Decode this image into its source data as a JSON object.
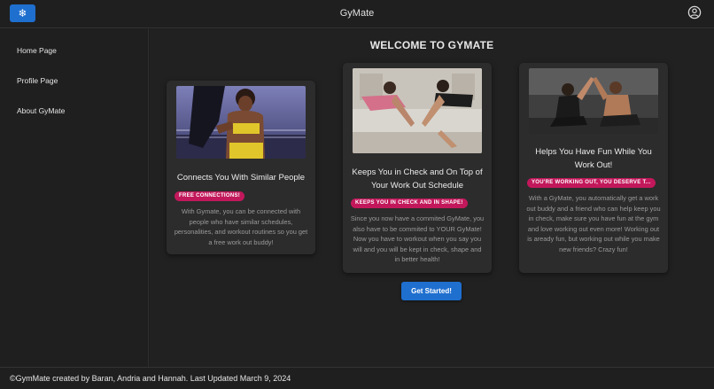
{
  "app": {
    "title": "GyMate",
    "menu_icon": "snowflake-menu-icon",
    "account_icon": "account-circle-icon"
  },
  "sidebar": {
    "items": [
      {
        "label": "Home Page"
      },
      {
        "label": "Profile Page"
      },
      {
        "label": "About GyMate"
      }
    ]
  },
  "main": {
    "heading": "WELCOME TO GYMATE",
    "cards": [
      {
        "image": "woman-training-with-partner-photo",
        "title": "Connects You With Similar People",
        "badge": "FREE CONNECTIONS!",
        "text": "With Gymate, you can be connected with people who have similar schedules, personalities, and workout routines so you get a free work out buddy!"
      },
      {
        "image": "women-plank-handshake-photo",
        "title": "Keeps You in Check and On Top of Your Work Out Schedule",
        "badge": "KEEPS YOU IN CHECK AND IN SHAPE!",
        "text": "Since you now have a commited GyMate, you also have to be commited to YOUR GyMate! Now you have to workout when you say you will and you will be kept in check, shape and in better health!"
      },
      {
        "image": "couple-high-five-gym-photo",
        "title": "Helps You Have Fun While You Work Out!",
        "badge": "YOU'RE WORKING OUT, YOU DESERVE T...",
        "text": "With a GyMate, you automatically get a work out buddy and a friend who can help keep you in check, make sure you have fun at the gym and love working out even more! Working out is aready fun, but working out while you make new friends? Crazy fun!"
      }
    ],
    "cta_label": "Get Started!"
  },
  "footer": {
    "text": "©GymMate created by Baran, Andria and Hannah. Last Updated March 9, 2024"
  },
  "colors": {
    "primary": "#1f6fcf",
    "badge": "#c2185b",
    "background": "#1e1e1e",
    "card": "#2c2c2c"
  }
}
